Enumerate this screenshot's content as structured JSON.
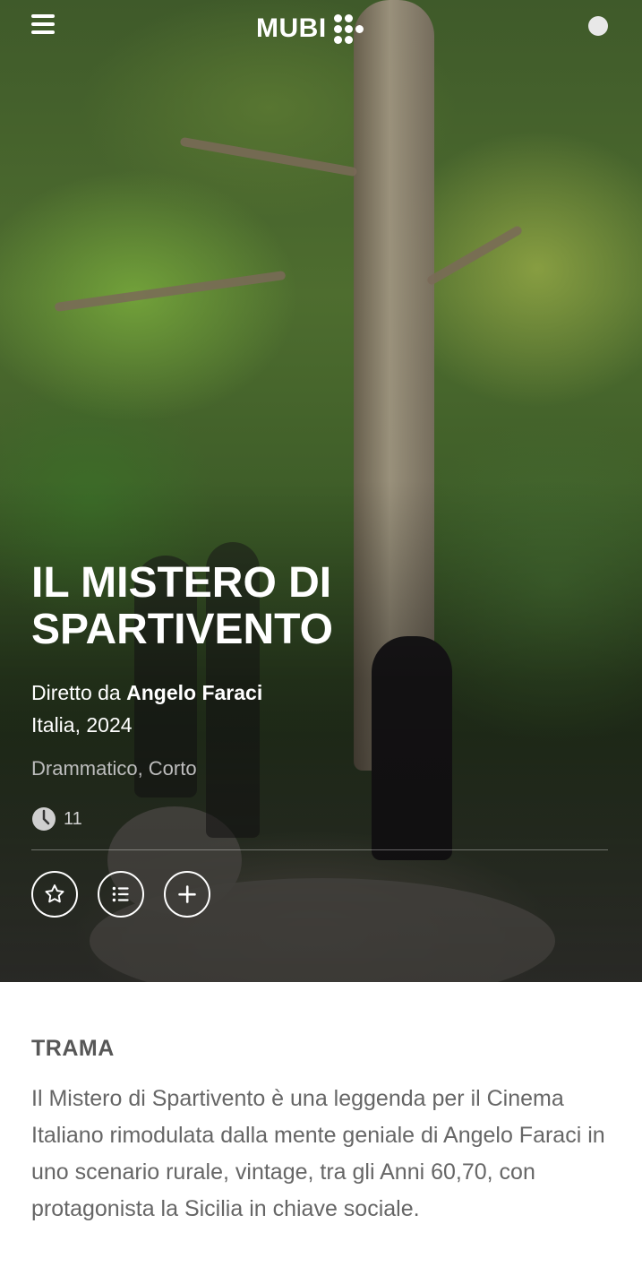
{
  "header": {
    "logo_text": "MUBI"
  },
  "film": {
    "title": "IL MISTERO DI SPARTIVENTO",
    "director_prefix": "Diretto da",
    "director_name": "Angelo Faraci",
    "country_year": "Italia, 2024",
    "genres": "Drammatico, Corto",
    "duration": "11"
  },
  "actions": [
    {
      "icon": "star-icon"
    },
    {
      "icon": "list-icon"
    },
    {
      "icon": "plus-icon"
    }
  ],
  "plot": {
    "heading": "TRAMA",
    "text": "Il Mistero di Spartivento è una leggenda per il Cinema Italiano rimodulata dalla mente geniale di Angelo Faraci in uno scenario rurale, vintage, tra gli Anni 60,70, con protagonista la Sicilia in chiave sociale."
  }
}
